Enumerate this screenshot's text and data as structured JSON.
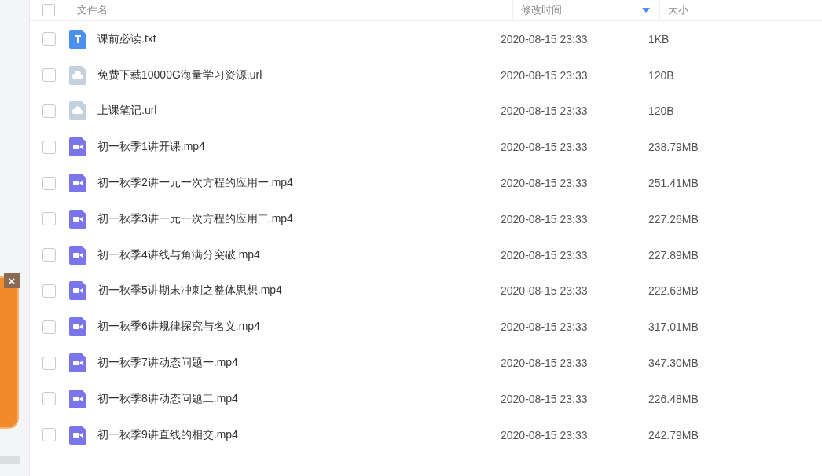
{
  "ad_panel": {
    "close": "×"
  },
  "table": {
    "select_all": {
      "checked": false
    },
    "columns": [
      {
        "label": "文件名",
        "sorted": false
      },
      {
        "label": "修改时间",
        "sorted": true
      },
      {
        "label": "大小",
        "sorted": false
      }
    ],
    "rows": [
      {
        "name": "课前必读.txt",
        "kind": "txt",
        "modified": "2020-08-15 23:33",
        "size": "1KB",
        "checked": false
      },
      {
        "name": "免费下载10000G海量学习资源.url",
        "kind": "url",
        "modified": "2020-08-15 23:33",
        "size": "120B",
        "checked": false
      },
      {
        "name": "上课笔记.url",
        "kind": "url",
        "modified": "2020-08-15 23:33",
        "size": "120B",
        "checked": false
      },
      {
        "name": "初一秋季1讲开课.mp4",
        "kind": "video",
        "modified": "2020-08-15 23:33",
        "size": "238.79MB",
        "checked": false
      },
      {
        "name": "初一秋季2讲一元一次方程的应用一.mp4",
        "kind": "video",
        "modified": "2020-08-15 23:33",
        "size": "251.41MB",
        "checked": false
      },
      {
        "name": "初一秋季3讲一元一次方程的应用二.mp4",
        "kind": "video",
        "modified": "2020-08-15 23:33",
        "size": "227.26MB",
        "checked": false
      },
      {
        "name": "初一秋季4讲线与角满分突破.mp4",
        "kind": "video",
        "modified": "2020-08-15 23:33",
        "size": "227.89MB",
        "checked": false
      },
      {
        "name": "初一秋季5讲期末冲刺之整体思想.mp4",
        "kind": "video",
        "modified": "2020-08-15 23:33",
        "size": "222.63MB",
        "checked": false
      },
      {
        "name": "初一秋季6讲规律探究与名义.mp4",
        "kind": "video",
        "modified": "2020-08-15 23:33",
        "size": "317.01MB",
        "checked": false
      },
      {
        "name": "初一秋季7讲动态问题一.mp4",
        "kind": "video",
        "modified": "2020-08-15 23:33",
        "size": "347.30MB",
        "checked": false
      },
      {
        "name": "初一秋季8讲动态问题二.mp4",
        "kind": "video",
        "modified": "2020-08-15 23:33",
        "size": "226.48MB",
        "checked": false
      },
      {
        "name": "初一秋季9讲直线的相交.mp4",
        "kind": "video",
        "modified": "2020-08-15 23:33",
        "size": "242.79MB",
        "checked": false
      }
    ]
  }
}
